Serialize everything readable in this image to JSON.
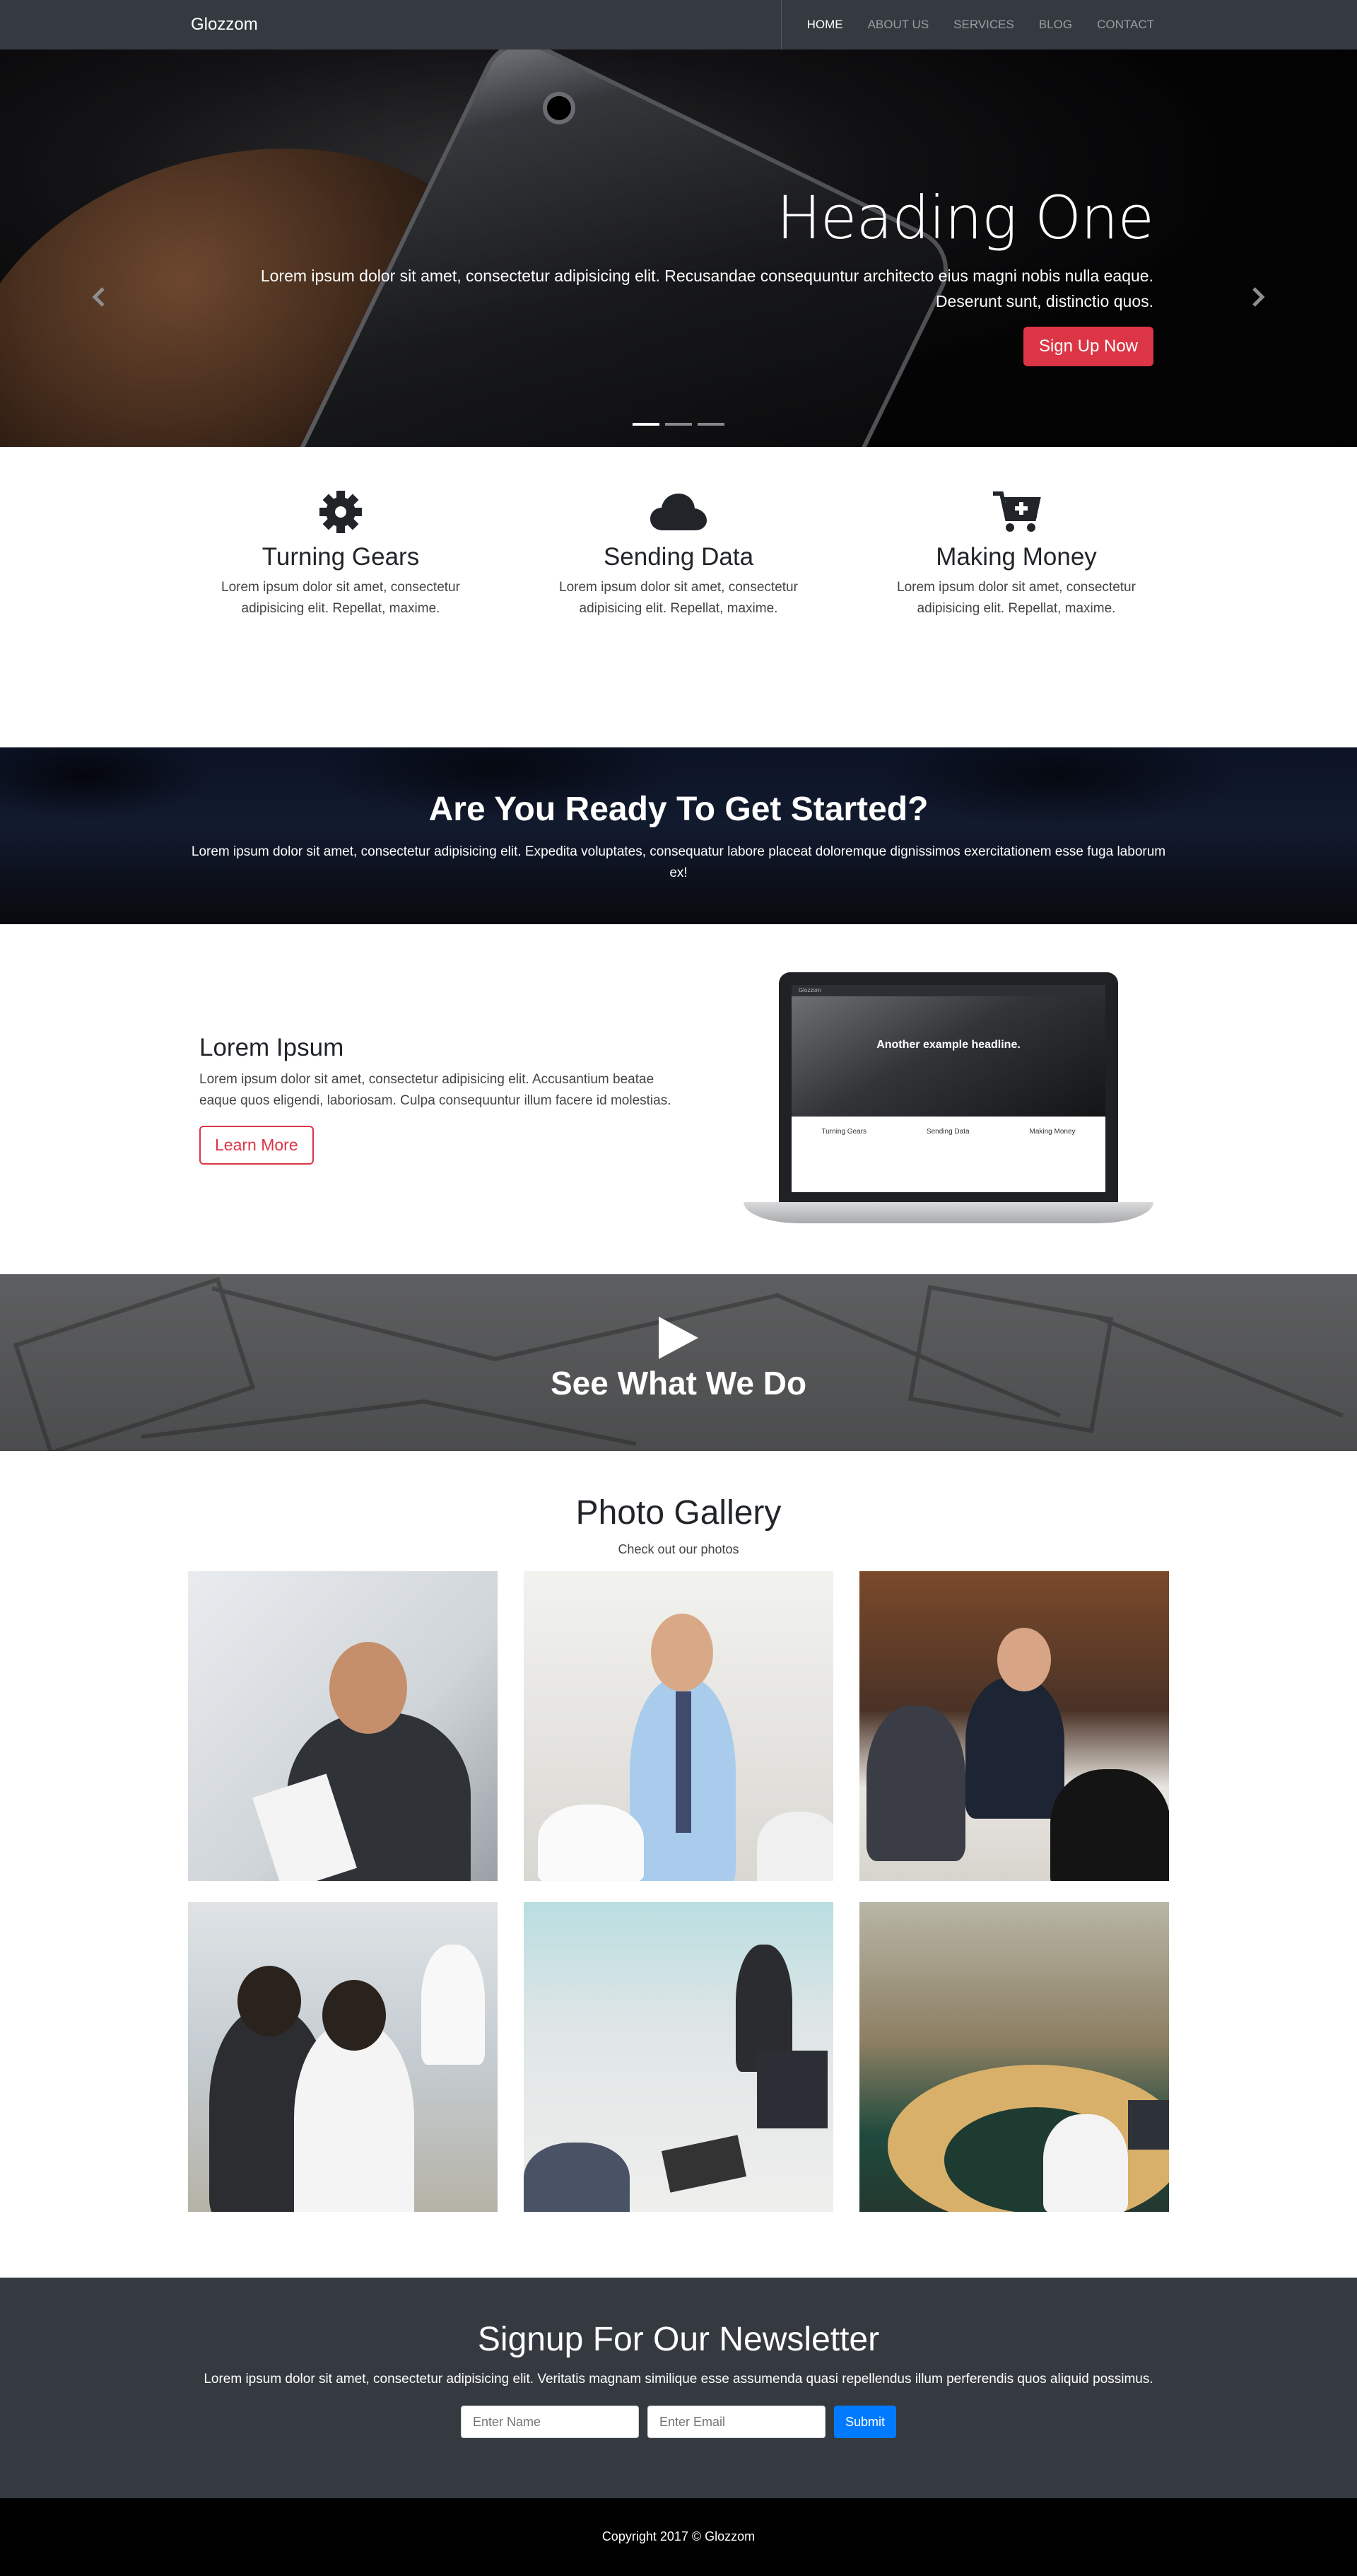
{
  "navbar": {
    "brand": "Glozzom",
    "links": [
      {
        "label": "HOME",
        "active": true
      },
      {
        "label": "ABOUT US"
      },
      {
        "label": "SERVICES"
      },
      {
        "label": "BLOG"
      },
      {
        "label": "CONTACT"
      }
    ]
  },
  "hero": {
    "heading": "Heading One",
    "text_line1": "Lorem ipsum dolor sit amet, consectetur adipisicing elit. Recusandae consequuntur architecto eius magni nobis nulla eaque.",
    "text_line2": "Deserunt sunt, distinctio quos.",
    "button": "Sign Up Now",
    "prev_icon": "chevron-left-icon",
    "next_icon": "chevron-right-icon",
    "slides": 3,
    "active_slide": 1
  },
  "features": [
    {
      "icon": "gear-icon",
      "title": "Turning Gears",
      "text": "Lorem ipsum dolor sit amet, consectetur adipisicing elit. Repellat, maxime."
    },
    {
      "icon": "cloud-icon",
      "title": "Sending Data",
      "text": "Lorem ipsum dolor sit amet, consectetur adipisicing elit. Repellat, maxime."
    },
    {
      "icon": "cart-plus-icon",
      "title": "Making Money",
      "text": "Lorem ipsum dolor sit amet, consectetur adipisicing elit. Repellat, maxime."
    }
  ],
  "cta": {
    "heading": "Are You Ready To Get Started?",
    "text": "Lorem ipsum dolor sit amet, consectetur adipisicing elit. Expedita voluptates, consequatur labore placeat doloremque dignissimos exercitationem esse fuga laborum ex!"
  },
  "about": {
    "heading": "Lorem Ipsum",
    "text": "Lorem ipsum dolor sit amet, consectetur adipisicing elit. Accusantium beatae eaque quos eligendi, laboriosam. Culpa consequuntur illum facere id molestias.",
    "button": "Learn More",
    "laptop_screen": {
      "brand": "Glozzom",
      "headline": "Another example headline.",
      "features": [
        "Turning Gears",
        "Sending Data",
        "Making Money"
      ]
    }
  },
  "video": {
    "icon": "play-icon",
    "heading": "See What We Do"
  },
  "gallery": {
    "heading": "Photo Gallery",
    "subheading": "Check out our photos",
    "photos": [
      "photo-1",
      "photo-2",
      "photo-3",
      "photo-4",
      "photo-5",
      "photo-6"
    ]
  },
  "newsletter": {
    "heading": "Signup For Our Newsletter",
    "text": "Lorem ipsum dolor sit amet, consectetur adipisicing elit. Veritatis magnam similique esse assumenda quasi repellendus illum perferendis quos aliquid possimus.",
    "name_placeholder": "Enter Name",
    "email_placeholder": "Enter Email",
    "submit": "Submit"
  },
  "footer": {
    "copyright": "Copyright 2017 © Glozzom"
  },
  "colors": {
    "navbar": "#343a40",
    "accent_red": "#dc3545",
    "submit_blue": "#007bff",
    "footer": "#000000"
  }
}
